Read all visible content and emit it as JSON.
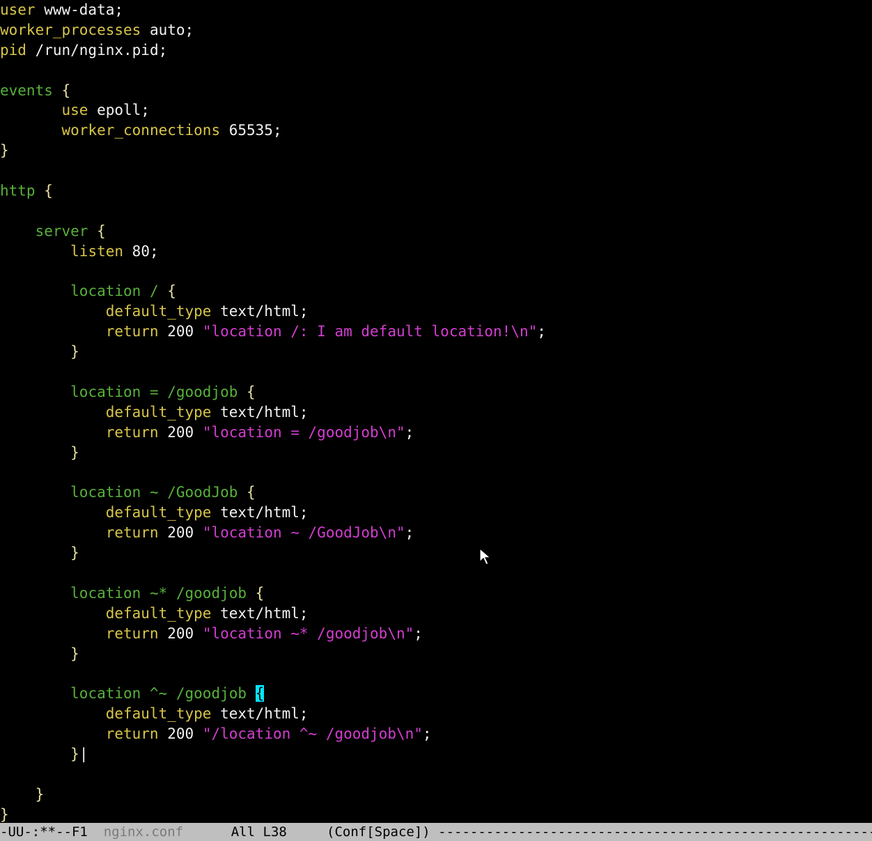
{
  "editor": {
    "lines": [
      [
        {
          "t": "user ",
          "c": "dir"
        },
        {
          "t": "www-data;",
          "c": "plain"
        }
      ],
      [
        {
          "t": "worker_processes ",
          "c": "dir"
        },
        {
          "t": "auto;",
          "c": "plain"
        }
      ],
      [
        {
          "t": "pid ",
          "c": "dir"
        },
        {
          "t": "/run/nginx.pid;",
          "c": "plain"
        }
      ],
      [],
      [
        {
          "t": "events ",
          "c": "kw"
        },
        {
          "t": "{",
          "c": "brace"
        }
      ],
      [
        {
          "t": "       ",
          "c": "plain"
        },
        {
          "t": "use ",
          "c": "dir"
        },
        {
          "t": "epoll;",
          "c": "plain"
        }
      ],
      [
        {
          "t": "       ",
          "c": "plain"
        },
        {
          "t": "worker_connections ",
          "c": "dir"
        },
        {
          "t": "65535;",
          "c": "plain"
        }
      ],
      [
        {
          "t": "}",
          "c": "brace"
        }
      ],
      [],
      [
        {
          "t": "http ",
          "c": "kw"
        },
        {
          "t": "{",
          "c": "brace"
        }
      ],
      [],
      [
        {
          "t": "    ",
          "c": "plain"
        },
        {
          "t": "server ",
          "c": "kw"
        },
        {
          "t": "{",
          "c": "brace"
        }
      ],
      [
        {
          "t": "        ",
          "c": "plain"
        },
        {
          "t": "listen ",
          "c": "dir"
        },
        {
          "t": "80;",
          "c": "plain"
        }
      ],
      [],
      [
        {
          "t": "        ",
          "c": "plain"
        },
        {
          "t": "location / ",
          "c": "kw"
        },
        {
          "t": "{",
          "c": "brace"
        }
      ],
      [
        {
          "t": "            ",
          "c": "plain"
        },
        {
          "t": "default_type ",
          "c": "dir"
        },
        {
          "t": "text/html;",
          "c": "plain"
        }
      ],
      [
        {
          "t": "            ",
          "c": "plain"
        },
        {
          "t": "return ",
          "c": "dir"
        },
        {
          "t": "200 ",
          "c": "plain"
        },
        {
          "t": "\"location /: I am default location!\\n\"",
          "c": "str"
        },
        {
          "t": ";",
          "c": "plain"
        }
      ],
      [
        {
          "t": "        ",
          "c": "plain"
        },
        {
          "t": "}",
          "c": "brace"
        }
      ],
      [],
      [
        {
          "t": "        ",
          "c": "plain"
        },
        {
          "t": "location = /goodjob ",
          "c": "kw"
        },
        {
          "t": "{",
          "c": "brace"
        }
      ],
      [
        {
          "t": "            ",
          "c": "plain"
        },
        {
          "t": "default_type ",
          "c": "dir"
        },
        {
          "t": "text/html;",
          "c": "plain"
        }
      ],
      [
        {
          "t": "            ",
          "c": "plain"
        },
        {
          "t": "return ",
          "c": "dir"
        },
        {
          "t": "200 ",
          "c": "plain"
        },
        {
          "t": "\"location = /goodjob\\n\"",
          "c": "str"
        },
        {
          "t": ";",
          "c": "plain"
        }
      ],
      [
        {
          "t": "        ",
          "c": "plain"
        },
        {
          "t": "}",
          "c": "brace"
        }
      ],
      [],
      [
        {
          "t": "        ",
          "c": "plain"
        },
        {
          "t": "location ~ /GoodJob ",
          "c": "kw"
        },
        {
          "t": "{",
          "c": "brace"
        }
      ],
      [
        {
          "t": "            ",
          "c": "plain"
        },
        {
          "t": "default_type ",
          "c": "dir"
        },
        {
          "t": "text/html;",
          "c": "plain"
        }
      ],
      [
        {
          "t": "            ",
          "c": "plain"
        },
        {
          "t": "return ",
          "c": "dir"
        },
        {
          "t": "200 ",
          "c": "plain"
        },
        {
          "t": "\"location ~ /GoodJob\\n\"",
          "c": "str"
        },
        {
          "t": ";",
          "c": "plain"
        }
      ],
      [
        {
          "t": "        ",
          "c": "plain"
        },
        {
          "t": "}",
          "c": "brace"
        }
      ],
      [],
      [
        {
          "t": "        ",
          "c": "plain"
        },
        {
          "t": "location ~* /goodjob ",
          "c": "kw"
        },
        {
          "t": "{",
          "c": "brace"
        }
      ],
      [
        {
          "t": "            ",
          "c": "plain"
        },
        {
          "t": "default_type ",
          "c": "dir"
        },
        {
          "t": "text/html;",
          "c": "plain"
        }
      ],
      [
        {
          "t": "            ",
          "c": "plain"
        },
        {
          "t": "return ",
          "c": "dir"
        },
        {
          "t": "200 ",
          "c": "plain"
        },
        {
          "t": "\"location ~* /goodjob\\n\"",
          "c": "str"
        },
        {
          "t": ";",
          "c": "plain"
        }
      ],
      [
        {
          "t": "        ",
          "c": "plain"
        },
        {
          "t": "}",
          "c": "brace"
        }
      ],
      [],
      [
        {
          "t": "        ",
          "c": "plain"
        },
        {
          "t": "location ^~ /goodjob ",
          "c": "kw"
        },
        {
          "t": "{",
          "c": "cursor"
        }
      ],
      [
        {
          "t": "            ",
          "c": "plain"
        },
        {
          "t": "default_type ",
          "c": "dir"
        },
        {
          "t": "text/html;",
          "c": "plain"
        }
      ],
      [
        {
          "t": "            ",
          "c": "plain"
        },
        {
          "t": "return ",
          "c": "dir"
        },
        {
          "t": "200 ",
          "c": "plain"
        },
        {
          "t": "\"/location ^~ /goodjob\\n\"",
          "c": "str"
        },
        {
          "t": ";",
          "c": "plain"
        }
      ],
      [
        {
          "t": "        ",
          "c": "plain"
        },
        {
          "t": "}",
          "c": "brace"
        },
        {
          "t": "|",
          "c": "bar"
        }
      ],
      [],
      [
        {
          "t": "    ",
          "c": "plain"
        },
        {
          "t": "}",
          "c": "brace"
        }
      ],
      [
        {
          "t": "}",
          "c": "brace"
        }
      ]
    ]
  },
  "mode_line": {
    "status": "-UU-:**--F1  ",
    "buffer_name": "nginx.conf",
    "position": "      All L38     ",
    "major_mode": "(Conf[Space])",
    "fill": " -----------------------------------------------------------"
  },
  "colors": {
    "background": "#000000",
    "directive": "#d8c54a",
    "keyword": "#57b13a",
    "string": "#d33ed0",
    "plain_text": "#f2f2f2",
    "brace": "#e8e0a0",
    "paren_match_highlight": "#00e5ff",
    "mode_line_background": "#bfbfbf"
  },
  "icons": {
    "pointer": "mouse-pointer-icon"
  }
}
